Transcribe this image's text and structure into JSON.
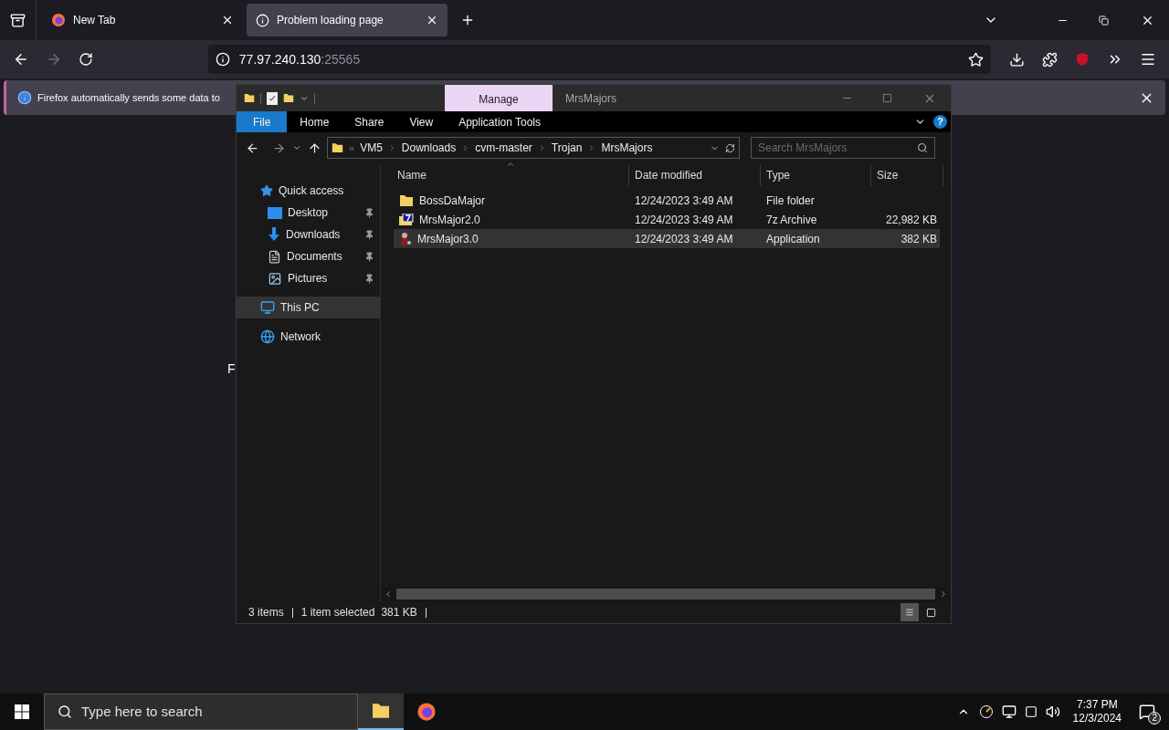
{
  "browser": {
    "tabs": [
      {
        "title": "New Tab",
        "selected": false
      },
      {
        "title": "Problem loading page",
        "selected": true
      }
    ],
    "url": {
      "host": "77.97.240.130",
      "port": ":25565"
    },
    "notification": "Firefox automatically sends some data to",
    "page_fragments": {
      "text": "F"
    }
  },
  "explorer": {
    "title": "MrsMajors",
    "contextual_tab": "Manage",
    "ribbon_tabs": [
      {
        "label": "File",
        "kind": "file"
      },
      {
        "label": "Home",
        "kind": "tab"
      },
      {
        "label": "Share",
        "kind": "tab"
      },
      {
        "label": "View",
        "kind": "tab"
      },
      {
        "label": "Application Tools",
        "kind": "tab"
      }
    ],
    "help": "?",
    "breadcrumb_overflow": "«",
    "breadcrumb": [
      "VM5",
      "Downloads",
      "cvm-master",
      "Trojan",
      "MrsMajors"
    ],
    "search": {
      "placeholder": "Search MrsMajors"
    },
    "nav": [
      {
        "label": "Quick access",
        "kind": "star",
        "selected": false,
        "children": [
          {
            "label": "Desktop",
            "kind": "desktop",
            "pinned": true,
            "selected": false
          },
          {
            "label": "Downloads",
            "kind": "download",
            "pinned": true,
            "selected": false
          },
          {
            "label": "Documents",
            "kind": "document",
            "pinned": true,
            "selected": false
          },
          {
            "label": "Pictures",
            "kind": "pictures",
            "pinned": true,
            "selected": false
          }
        ]
      },
      {
        "label": "This PC",
        "kind": "pc",
        "selected": true
      },
      {
        "label": "Network",
        "kind": "network",
        "selected": false
      }
    ],
    "columns": [
      "Name",
      "Date modified",
      "Type",
      "Size"
    ],
    "rows": [
      {
        "name": "BossDaMajor",
        "kind": "folder",
        "date": "12/24/2023 3:49 AM",
        "type": "File folder",
        "selected": false
      },
      {
        "name": "MrsMajor2.0",
        "kind": "archive",
        "date": "12/24/2023 3:49 AM",
        "type": "7z Archive",
        "size": "22,982 KB",
        "selected": false
      },
      {
        "name": "MrsMajor3.0",
        "kind": "application",
        "date": "12/24/2023 3:49 AM",
        "type": "Application",
        "size": "382 KB",
        "selected": true
      }
    ],
    "status": {
      "count": "3 items",
      "selection": "1 item selected",
      "size": "381 KB"
    }
  },
  "taskbar": {
    "search_placeholder": "Type here to search",
    "time": "7:37 PM",
    "date": "12/3/2024",
    "notifications": "2"
  }
}
